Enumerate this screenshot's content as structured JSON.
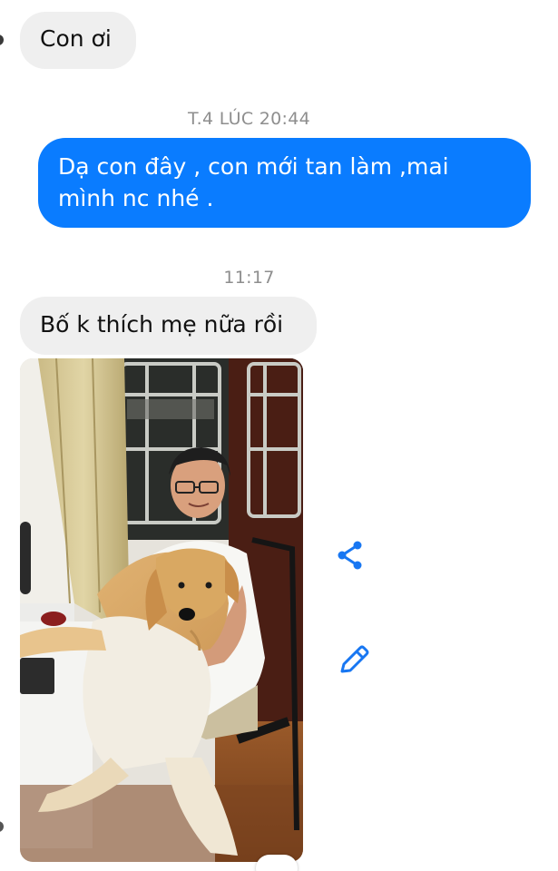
{
  "thread": {
    "messages": [
      {
        "direction": "incoming",
        "text": "Con ơi"
      },
      {
        "direction": "outgoing",
        "text": "Dạ con đây , con mới tan làm ,mai mình nc nhé ."
      },
      {
        "direction": "incoming",
        "text": "Bố k thích mẹ nữa rồi"
      }
    ],
    "timestamps": [
      "T.4 LÚC 20:44",
      "11:17"
    ]
  },
  "photo_actions": {
    "icons": [
      "share-icon",
      "edit-pencil-icon"
    ],
    "accent_color": "#1877f2"
  },
  "colors": {
    "incoming_bubble": "#efefef",
    "outgoing_bubble": "#0a7cff",
    "timestamp_text": "#8e8e8e"
  }
}
